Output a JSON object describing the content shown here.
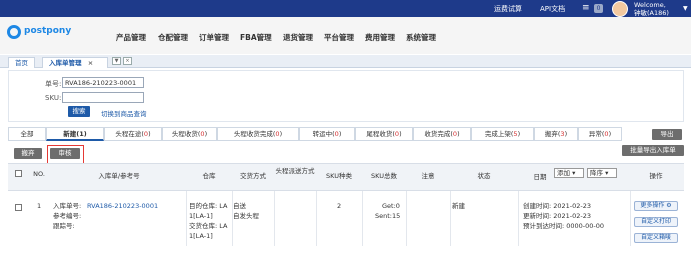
{
  "topbar": {
    "freight": "运费试算",
    "api_doc": "API文档",
    "badge": "0",
    "welcome": "Welcome,",
    "user": "钟敏(A186)"
  },
  "brand": {
    "name": "postpony",
    "accent": "#1e88e5",
    "topbar_color": "#1e3a8a"
  },
  "nav": [
    "产品管理",
    "仓配管理",
    "订单管理",
    "FBA管理",
    "退货管理",
    "平台管理",
    "费用管理",
    "系统管理"
  ],
  "tabs": {
    "home": "首页",
    "current": "入库单管理",
    "close": "×"
  },
  "search": {
    "no_label": "单号:",
    "no_value": "RVA186-210223-0001",
    "sku_label": "SKU:",
    "sku_value": "",
    "button": "搜索",
    "customer_link": "切换到商品查询"
  },
  "status_tabs": [
    {
      "name": "全部",
      "count": ""
    },
    {
      "name": "新建",
      "count": "1"
    },
    {
      "name": "头程在途",
      "count": "0"
    },
    {
      "name": "头程收货",
      "count": "0"
    },
    {
      "name": "头程收货完成",
      "count": "0"
    },
    {
      "name": "转运中",
      "count": "0"
    },
    {
      "name": "尾程收货",
      "count": "0"
    },
    {
      "name": "收货完成",
      "count": "0"
    },
    {
      "name": "完成上架",
      "count": "5"
    },
    {
      "name": "搬弃",
      "count": "3"
    },
    {
      "name": "异常",
      "count": "0"
    }
  ],
  "actions": {
    "export": "导出",
    "batch_export": "批量导出入库单",
    "discard": "搬弃",
    "approve": "审核"
  },
  "columns": {
    "no": "NO.",
    "order": "入库单/参考号",
    "warehouse": "仓库",
    "delivery": "交货方式",
    "head_method": "头程派送方式",
    "sku_type": "SKU种类",
    "sku_total": "SKU总数",
    "note": "注意",
    "status": "状态",
    "date": "日期",
    "op": "操作"
  },
  "sort": {
    "field": "添加",
    "order": "降序"
  },
  "rows": [
    {
      "no": "1",
      "inbound_label": "入库单号:",
      "inbound_no": "RVA186-210223-0001",
      "ref_label": "参考编号:",
      "track_label": "跟踪号:",
      "wh1": "目的仓库: LA",
      "wh1b": "1[LA-1]",
      "wh2": "交货仓库: LA",
      "wh2b": "1[LA-1]",
      "delivery1": "自送",
      "delivery2": "自发头程",
      "sku_type": "2",
      "get": "Get:0",
      "sent": "Sent:15",
      "status": "新建",
      "created": "创建时间:   2021-02-23",
      "updated": "更新时间:   2021-02-23",
      "eta": "预计到达时间:   0000-00-00",
      "btn_more": "更多操作",
      "btn_print": "自定义打印",
      "btn_label": "自定义箱唛"
    }
  ]
}
